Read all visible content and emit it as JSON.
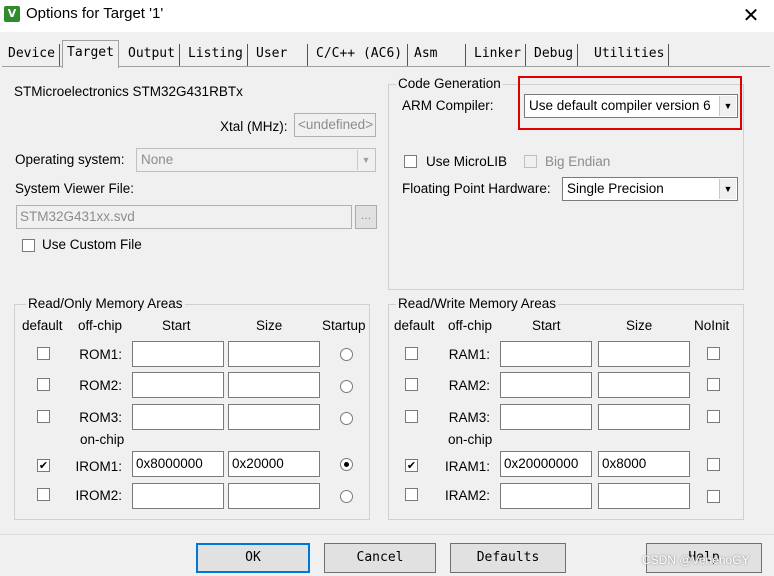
{
  "window": {
    "title": "Options for Target '1'",
    "icon": "µvision-icon",
    "icon_glyph": "V"
  },
  "tabs": [
    "Device",
    "Target",
    "Output",
    "Listing",
    "User",
    "C/C++ (AC6)",
    "Asm",
    "Linker",
    "Debug",
    "Utilities"
  ],
  "active_tab": "Target",
  "device": {
    "name": "STMicroelectronics STM32G431RBTx",
    "xtal_label": "Xtal (MHz):",
    "xtal_value": "<undefined>",
    "os_label": "Operating system:",
    "os_value": "None",
    "svf_label": "System Viewer File:",
    "svf_value": "STM32G431xx.svd",
    "browse_label": "...",
    "custom_file_label": "Use Custom File"
  },
  "code_gen": {
    "title": "Code Generation",
    "compiler_label": "ARM Compiler:",
    "compiler_value": "Use default compiler version 6",
    "microlib_label": "Use MicroLIB",
    "big_endian_label": "Big Endian",
    "fpu_label": "Floating Point Hardware:",
    "fpu_value": "Single Precision"
  },
  "ro_memory": {
    "title": "Read/Only Memory Areas",
    "headers": {
      "default": "default",
      "offchip": "off-chip",
      "start": "Start",
      "size": "Size",
      "startup": "Startup"
    },
    "onchip_label": "on-chip",
    "rows": [
      {
        "label": "ROM1:",
        "start": "",
        "size": "",
        "default": false,
        "startup": false
      },
      {
        "label": "ROM2:",
        "start": "",
        "size": "",
        "default": false,
        "startup": false
      },
      {
        "label": "ROM3:",
        "start": "",
        "size": "",
        "default": false,
        "startup": false
      },
      {
        "label": "IROM1:",
        "start": "0x8000000",
        "size": "0x20000",
        "default": true,
        "startup": true
      },
      {
        "label": "IROM2:",
        "start": "",
        "size": "",
        "default": false,
        "startup": false
      }
    ]
  },
  "rw_memory": {
    "title": "Read/Write Memory Areas",
    "headers": {
      "default": "default",
      "offchip": "off-chip",
      "start": "Start",
      "size": "Size",
      "noinit": "NoInit"
    },
    "onchip_label": "on-chip",
    "rows": [
      {
        "label": "RAM1:",
        "start": "",
        "size": "",
        "default": false,
        "noinit": false
      },
      {
        "label": "RAM2:",
        "start": "",
        "size": "",
        "default": false,
        "noinit": false
      },
      {
        "label": "RAM3:",
        "start": "",
        "size": "",
        "default": false,
        "noinit": false
      },
      {
        "label": "IRAM1:",
        "start": "0x20000000",
        "size": "0x8000",
        "default": true,
        "noinit": false
      },
      {
        "label": "IRAM2:",
        "start": "",
        "size": "",
        "default": false,
        "noinit": false
      }
    ]
  },
  "buttons": {
    "ok": "OK",
    "cancel": "Cancel",
    "defaults": "Defaults",
    "help": "Help"
  },
  "watermark": "CSDN @VenenoGY",
  "glyphs": {
    "close": "✕",
    "combo_arrow": "▼",
    "check": "✔"
  },
  "colors": {
    "highlight": "#e00000",
    "default_button_border": "#0078d7"
  }
}
